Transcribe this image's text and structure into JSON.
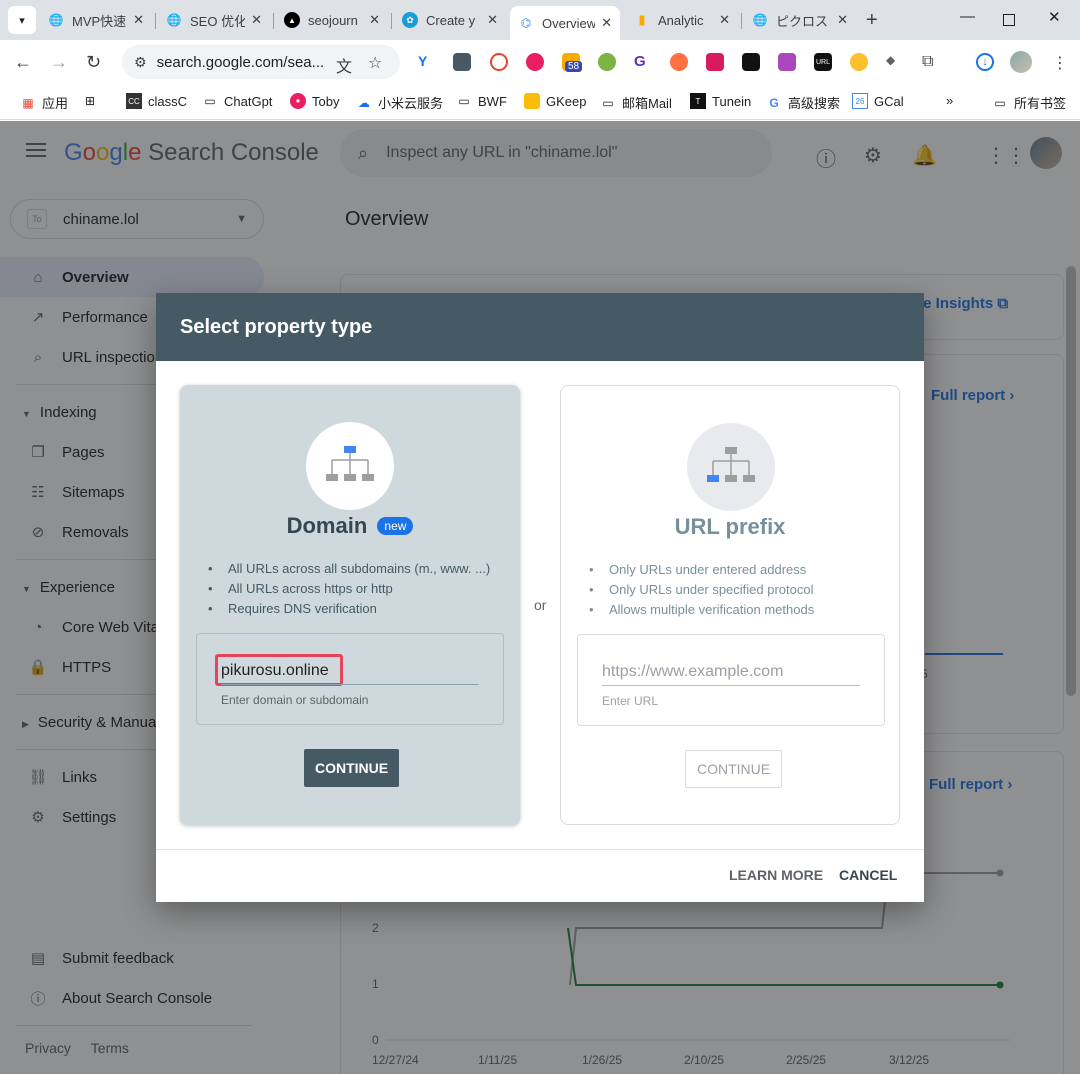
{
  "browser": {
    "tabs": [
      {
        "label": "MVP快速",
        "active": false
      },
      {
        "label": "SEO 优化",
        "active": false
      },
      {
        "label": "seojourn",
        "active": false
      },
      {
        "label": "Create y",
        "active": false
      },
      {
        "label": "Overview",
        "active": true
      },
      {
        "label": "Analytic",
        "active": false
      },
      {
        "label": "ピクロス",
        "active": false
      }
    ],
    "address": "search.google.com/sea...",
    "extension_badge": "58",
    "bookmarks": [
      "应用",
      "classC",
      "ChatGpt",
      "Toby",
      "小米云服务",
      "BWF",
      "GKeep",
      "邮箱Mail",
      "Tunein",
      "高级搜索",
      "GCal",
      "所有书签"
    ]
  },
  "gsc": {
    "logo": {
      "google": [
        "G",
        "o",
        "o",
        "g",
        "l",
        "e"
      ],
      "product": "Search Console"
    },
    "search_placeholder": "Inspect any URL in \"chiname.lol\"",
    "property": "chiname.lol",
    "property_favicon": "To",
    "nav": [
      {
        "label": "Overview",
        "icon": "home-icon",
        "active": true
      },
      {
        "label": "Performance",
        "icon": "trending-up-icon"
      },
      {
        "label": "URL inspection",
        "icon": "search-icon"
      }
    ],
    "sections": {
      "indexing": {
        "label": "Indexing",
        "items": [
          {
            "label": "Pages",
            "icon": "pages-icon"
          },
          {
            "label": "Sitemaps",
            "icon": "sitemap-icon"
          },
          {
            "label": "Removals",
            "icon": "removals-icon"
          }
        ]
      },
      "experience": {
        "label": "Experience",
        "items": [
          {
            "label": "Core Web Vitals",
            "icon": "speed-icon"
          },
          {
            "label": "HTTPS",
            "icon": "lock-icon"
          }
        ]
      },
      "security": {
        "label": "Security & Manual Actions"
      }
    },
    "other_nav": [
      {
        "label": "Links",
        "icon": "links-icon"
      },
      {
        "label": "Settings",
        "icon": "gear-icon"
      }
    ],
    "bottom_nav": [
      {
        "label": "Submit feedback",
        "icon": "feedback-icon"
      },
      {
        "label": "About Search Console",
        "icon": "info-icon"
      }
    ],
    "footer": {
      "privacy": "Privacy",
      "terms": "Terms"
    },
    "main_title": "Overview",
    "insights_link": "le Insights",
    "full_report": "Full report",
    "chart_y_ticks": [
      "2",
      "1",
      "0"
    ],
    "chart_x_ticks": [
      "12/27/24",
      "1/11/25",
      "1/26/25",
      "2/10/25",
      "2/25/25",
      "3/12/25"
    ],
    "partial_tick": "5"
  },
  "modal": {
    "title": "Select property type",
    "or": "or",
    "domain": {
      "title": "Domain",
      "badge": "new",
      "bullets": [
        "All URLs across all subdomains (m., www. ...)",
        "All URLs across https or http",
        "Requires DNS verification"
      ],
      "input_value": "pikurosu.online",
      "hint": "Enter domain or subdomain",
      "button": "CONTINUE"
    },
    "prefix": {
      "title": "URL prefix",
      "bullets": [
        "Only URLs under entered address",
        "Only URLs under specified protocol",
        "Allows multiple verification methods"
      ],
      "placeholder": "https://www.example.com",
      "hint": "Enter URL",
      "button": "CONTINUE"
    },
    "learn_more": "LEARN MORE",
    "cancel": "CANCEL"
  },
  "colors": {
    "accent": "#1a73e8",
    "modal_header": "#455a64",
    "highlight": "#e8435d"
  }
}
